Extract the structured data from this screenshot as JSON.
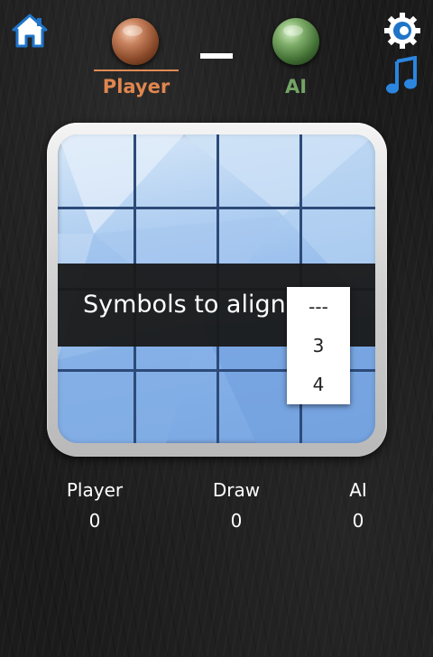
{
  "header": {
    "player_name": "Player",
    "ai_name": "AI",
    "player_color": "#e0864f",
    "ai_color": "#73a566",
    "icons": [
      "home-icon",
      "settings-icon",
      "music-note-icon"
    ]
  },
  "dialog": {
    "title": "Symbols to align",
    "options": [
      "---",
      "3",
      "4"
    ]
  },
  "scores": {
    "player_label": "Player",
    "player_value": "0",
    "draw_label": "Draw",
    "draw_value": "0",
    "ai_label": "AI",
    "ai_value": "0"
  }
}
